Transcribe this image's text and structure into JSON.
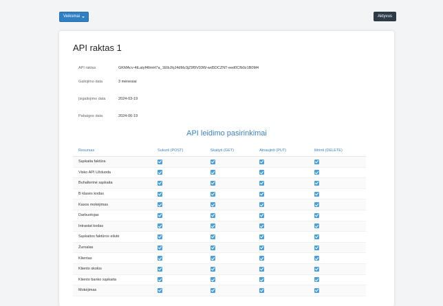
{
  "header": {
    "actions_label": "Veiksmai",
    "active_label": "Aktyvus"
  },
  "card": {
    "title": "API raktas 1",
    "info": [
      {
        "label": "API raktas",
        "value": "GKMAcv-4tLatyf4ltmH7a_1ElbJhjJ4dMz3jZ9f9V03W-wd5DCZNT-eed0Cfb0z1B0M4"
      },
      {
        "label": "Galiojimo data",
        "value": "3 mėnesiai"
      },
      {
        "label": "Įsigaliojimo data",
        "value": "2024-03-19"
      },
      {
        "label": "Pabaigos data",
        "value": "2024-06-19"
      }
    ],
    "permissions_title": "API leidimo pasirinkimai",
    "columns": [
      "Resursas",
      "Sukurti (POST)",
      "Skaityti (GET)",
      "Atnaujinti (PUT)",
      "Ištrinti (DELETE)"
    ],
    "rows": [
      {
        "resource": "Sąskaita faktūra",
        "post": true,
        "get": true,
        "put": true,
        "delete": true
      },
      {
        "resource": "Visko API Užduoda",
        "post": true,
        "get": true,
        "put": true,
        "delete": true
      },
      {
        "resource": "Buhalterinė sąskaita",
        "post": true,
        "get": true,
        "put": true,
        "delete": true
      },
      {
        "resource": "B klasės kodas",
        "post": true,
        "get": true,
        "put": true,
        "delete": true
      },
      {
        "resource": "Kasos mokėjimas",
        "post": true,
        "get": true,
        "put": true,
        "delete": true
      },
      {
        "resource": "Darbuotojas",
        "post": true,
        "get": true,
        "put": true,
        "delete": true
      },
      {
        "resource": "Intrastat kodas",
        "post": true,
        "get": true,
        "put": true,
        "delete": true
      },
      {
        "resource": "Sąskaitos faktūros eilutė",
        "post": true,
        "get": true,
        "put": true,
        "delete": true
      },
      {
        "resource": "Žurnalas",
        "post": true,
        "get": true,
        "put": true,
        "delete": true
      },
      {
        "resource": "Klientas",
        "post": true,
        "get": true,
        "put": true,
        "delete": true
      },
      {
        "resource": "Kliento skolos",
        "post": true,
        "get": true,
        "put": true,
        "delete": true
      },
      {
        "resource": "Kliento banko sąskaita",
        "post": true,
        "get": true,
        "put": true,
        "delete": true
      },
      {
        "resource": "Mokėjimas",
        "post": true,
        "get": true,
        "put": true,
        "delete": true
      }
    ]
  }
}
